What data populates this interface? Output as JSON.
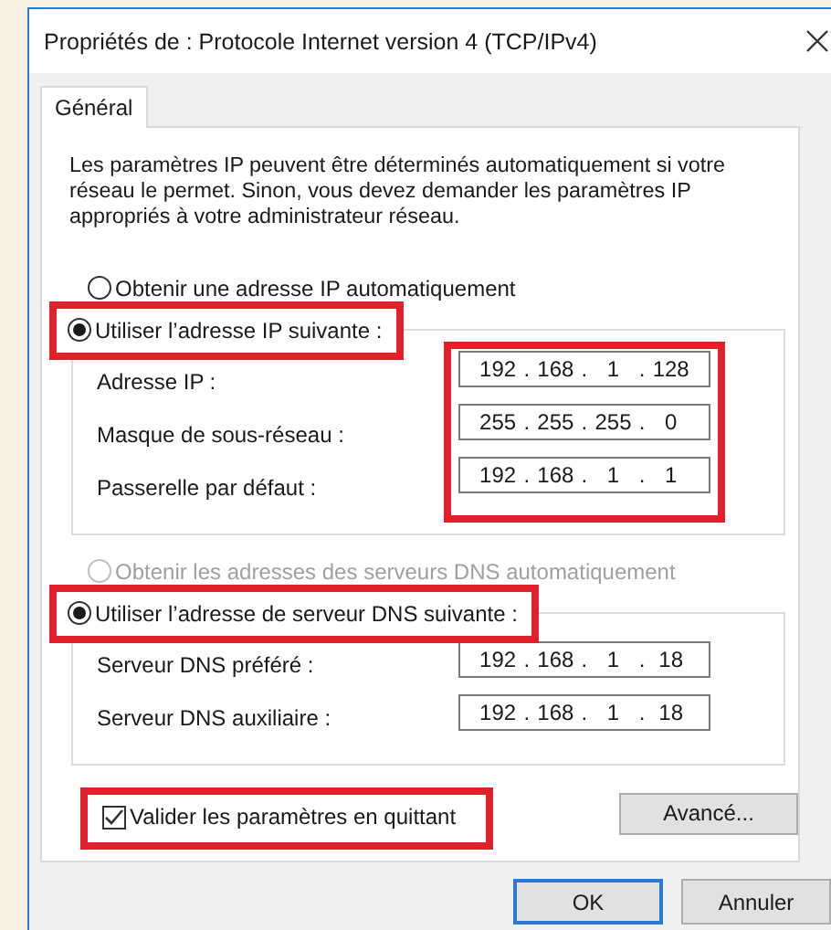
{
  "window": {
    "title": "Propriétés de : Protocole Internet version 4 (TCP/IPv4)"
  },
  "tabs": [
    {
      "label": "Général",
      "selected": true
    }
  ],
  "description": "Les paramètres IP peuvent être déterminés automatiquement si votre réseau le permet. Sinon, vous devez demander les paramètres IP appropriés à votre administrateur réseau.",
  "groups": [
    {
      "options": [
        {
          "label": "Obtenir une adresse IP automatiquement",
          "selected": false,
          "disabled": false,
          "highlighted": false
        },
        {
          "label": "Utiliser l’adresse IP suivante :",
          "selected": true,
          "disabled": false,
          "highlighted": true
        }
      ],
      "fields_highlighted": true,
      "fields": [
        {
          "label": "Adresse IP :",
          "separator": ".",
          "octets": [
            "192",
            "168",
            "1",
            "128"
          ]
        },
        {
          "label": "Masque de sous-réseau :",
          "separator": ".",
          "octets": [
            "255",
            "255",
            "255",
            "0"
          ]
        },
        {
          "label": "Passerelle par défaut :",
          "separator": ".",
          "octets": [
            "192",
            "168",
            "1",
            "1"
          ]
        }
      ]
    },
    {
      "options": [
        {
          "label": "Obtenir les adresses des serveurs DNS automatiquement",
          "selected": false,
          "disabled": true,
          "highlighted": false
        },
        {
          "label": "Utiliser l’adresse de serveur DNS suivante :",
          "selected": true,
          "disabled": false,
          "highlighted": true
        }
      ],
      "fields_highlighted": false,
      "fields": [
        {
          "label": "Serveur DNS préféré :",
          "separator": ".",
          "octets": [
            "192",
            "168",
            "1",
            "18"
          ]
        },
        {
          "label": "Serveur DNS auxiliaire :",
          "separator": ".",
          "octets": [
            "192",
            "168",
            "1",
            "18"
          ]
        }
      ]
    }
  ],
  "validate": {
    "label": "Valider les paramètres en quittant",
    "checked": true,
    "highlighted": true
  },
  "advanced_button": {
    "label": "Avancé..."
  },
  "footer_buttons": [
    {
      "label": "OK",
      "default": true
    },
    {
      "label": "Annuler",
      "default": false
    }
  ]
}
